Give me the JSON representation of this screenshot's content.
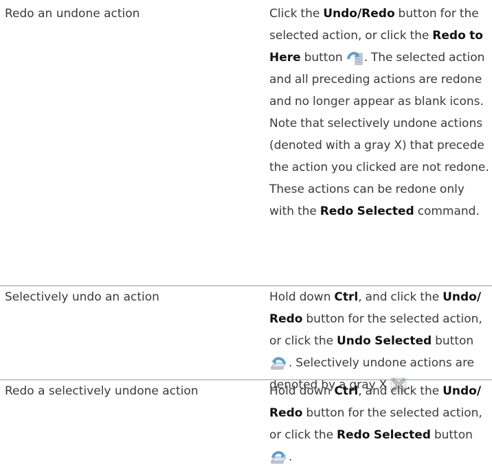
{
  "rows": [
    {
      "action": "Redo an undone action",
      "desc": {
        "t1": "Click the ",
        "b1": "Undo/Redo",
        "t2": " button for the selected action, or click the ",
        "b2": "Redo to Here",
        "t3": " button ",
        "icon1": "redo-to-here-icon",
        "t4": ". The selected action and all preceding actions are redone and no longer appear as blank icons. Note that selectively undone actions (denoted with a gray X) that precede the action you clicked are not redone. These actions can be redone only with the ",
        "b3": "Redo Selected",
        "t5": " command."
      }
    },
    {
      "action": "Selectively undo an action",
      "desc": {
        "t1": "Hold down ",
        "b1": "Ctrl",
        "t2": ", and click the ",
        "b2": "Undo/ Redo",
        "t3": " button for the selected action, or click the ",
        "b3": "Undo Selected",
        "t4": " button ",
        "icon1": "undo-selected-icon",
        "t5": ". Selectively undone actions are denoted by a gray X ",
        "icon2": "gray-x-icon",
        "t6": "."
      }
    },
    {
      "action": "Redo a selectively undone action",
      "desc": {
        "t1": "Hold down ",
        "b1": "Ctrl",
        "t2": ", and click the ",
        "b2": "Undo/ Redo",
        "t3": " button for the selected action, or click the ",
        "b3": "Redo Selected",
        "t4": " button ",
        "icon1": "redo-selected-icon",
        "t5": "."
      }
    }
  ],
  "colors": {
    "text": "#3a3a3a",
    "bold_text": "#111111",
    "separator": "#9a9a9a",
    "icon_blue": "#5a9bd4",
    "icon_gray": "#9aa6b2"
  }
}
